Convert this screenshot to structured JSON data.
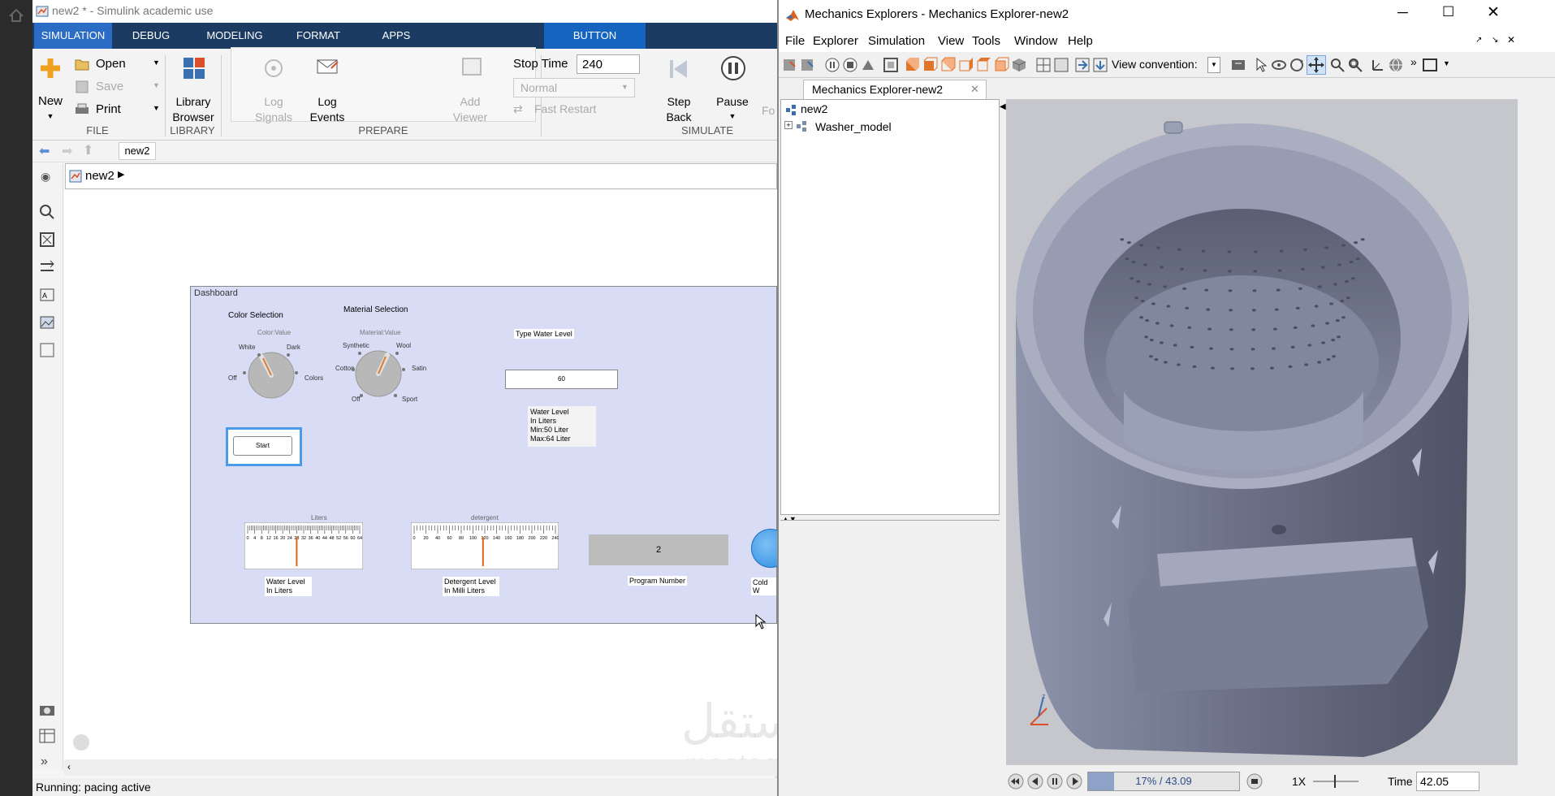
{
  "simulink": {
    "title": "new2 * - Simulink academic use",
    "tabs": [
      "SIMULATION",
      "DEBUG",
      "MODELING",
      "FORMAT",
      "APPS",
      "BUTTON"
    ],
    "ribbon": {
      "new": "New",
      "open": "Open",
      "save": "Save",
      "print": "Print",
      "file_section": "FILE",
      "library_browser": [
        "Library",
        "Browser"
      ],
      "library_section": "LIBRARY",
      "log_signals": [
        "Log",
        "Signals"
      ],
      "log_events": [
        "Log",
        "Events"
      ],
      "add_viewer": [
        "Add",
        "Viewer"
      ],
      "prepare_section": "PREPARE",
      "stop_time_label": "Stop Time",
      "stop_time_value": "240",
      "mode": "Normal",
      "fast_restart": "Fast Restart",
      "step_back": [
        "Step",
        "Back"
      ],
      "pause": "Pause",
      "simulate_section": "SIMULATE",
      "cut_label": "Fo"
    },
    "nav_tab": "new2",
    "breadcrumb": "new2",
    "status": "Running: pacing active",
    "dashboard": {
      "title": "Dashboard",
      "color_selection": "Color Selection",
      "color_value": "Color:Value",
      "color_knob": [
        "White",
        "Dark",
        "Off",
        "Colors"
      ],
      "material_selection": "Material Selection",
      "material_value": "Material:Value",
      "material_knob": [
        "Synthetic",
        "Wool",
        "Cotton",
        "Satin",
        "Off",
        "Sport"
      ],
      "type_water_level": "Type Water Level",
      "water_input": "60",
      "water_info": [
        "Water Level",
        "In Liters",
        "Min:50 Liter",
        "Max:64 Liter"
      ],
      "start": "Start",
      "gauge1_title": "Liters",
      "gauge1_ticks": [
        "0",
        "4",
        "8",
        "12",
        "16",
        "20",
        "24",
        "28",
        "32",
        "36",
        "40",
        "44",
        "48",
        "52",
        "56",
        "60",
        "64"
      ],
      "gauge1_value": 28,
      "gauge1_max": 64,
      "gauge1_label": [
        "Water Level",
        "In Liters"
      ],
      "gauge2_title": "detergent",
      "gauge2_ticks": [
        "0",
        "20",
        "40",
        "60",
        "80",
        "100",
        "120",
        "140",
        "160",
        "180",
        "200",
        "220",
        "240"
      ],
      "gauge2_value": 117,
      "gauge2_max": 240,
      "gauge2_label": [
        "Detergent Level",
        "In Milli Liters"
      ],
      "program_number_value": "2",
      "program_number_label": "Program Number",
      "cold_water_label": "Cold W"
    },
    "watermark": [
      "مستقل",
      "mostaql.com"
    ]
  },
  "mechanics": {
    "title": "Mechanics Explorers - Mechanics Explorer-new2",
    "menu": [
      "File",
      "Explorer",
      "Simulation",
      "View",
      "Tools",
      "Window",
      "Help"
    ],
    "view_convention_label": "View convention:",
    "tab": "Mechanics Explorer-new2",
    "tree": [
      "new2",
      "Washer_model"
    ],
    "playback_progress": "17% / 43.09",
    "playback_fraction": 0.17,
    "speed": "1X",
    "time_label": "Time",
    "time_value": "42.05"
  },
  "colors": {
    "ribbon_tab_bg": "#1b3b63",
    "active_tab": "#2b6cc4",
    "button_tab": "#1565c0",
    "dashboard_bg": "#d9dcf5",
    "viewport_bg": "#c5c7cc",
    "washer_body": "#8c93aa"
  }
}
